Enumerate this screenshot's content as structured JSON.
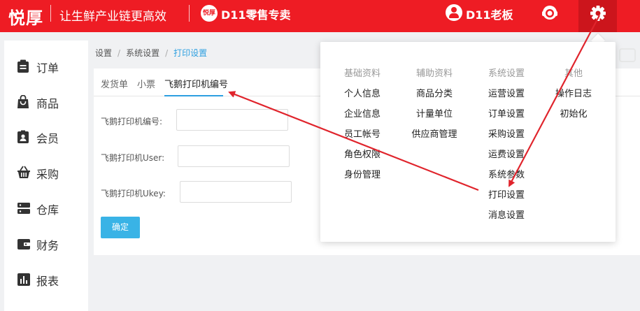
{
  "header": {
    "logo": "悦厚",
    "slogan": "让生鲜产业链更高效",
    "store_badge": "悦厚",
    "store_name": "D11零售专卖",
    "user_name": "D11老板"
  },
  "sidebar": {
    "items": [
      {
        "label": "订单",
        "icon": "clipboard-icon"
      },
      {
        "label": "商品",
        "icon": "shopping-bag-icon"
      },
      {
        "label": "会员",
        "icon": "member-badge-icon"
      },
      {
        "label": "采购",
        "icon": "basket-icon"
      },
      {
        "label": "仓库",
        "icon": "server-icon"
      },
      {
        "label": "财务",
        "icon": "wallet-icon"
      },
      {
        "label": "报表",
        "icon": "bar-chart-icon"
      }
    ]
  },
  "breadcrumb": [
    "设置",
    "系统设置",
    "打印设置"
  ],
  "tabs": [
    "发货单",
    "小票",
    "飞鹅打印机编号"
  ],
  "form": {
    "fields": [
      {
        "label": "飞鹅打印机编号:",
        "value": ""
      },
      {
        "label": "飞鹅打印机User:",
        "value": ""
      },
      {
        "label": "飞鹅打印机Ukey:",
        "value": ""
      }
    ],
    "submit_label": "确定"
  },
  "settings_menu": {
    "columns": [
      {
        "heading": "基础资料",
        "items": [
          "个人信息",
          "企业信息",
          "员工帐号",
          "角色权限",
          "身份管理"
        ]
      },
      {
        "heading": "辅助资料",
        "items": [
          "商品分类",
          "计量单位",
          "供应商管理"
        ]
      },
      {
        "heading": "系统设置",
        "items": [
          "运营设置",
          "订单设置",
          "采购设置",
          "运费设置",
          "系统参数",
          "打印设置",
          "消息设置"
        ]
      },
      {
        "heading": "其他",
        "items": [
          "操作日志",
          "初始化"
        ]
      }
    ]
  },
  "colors": {
    "header_red": "#ee1c24",
    "accent_blue": "#2d9fe0",
    "button_blue": "#39b3e6",
    "annotation_arrow": "#e0242c"
  }
}
